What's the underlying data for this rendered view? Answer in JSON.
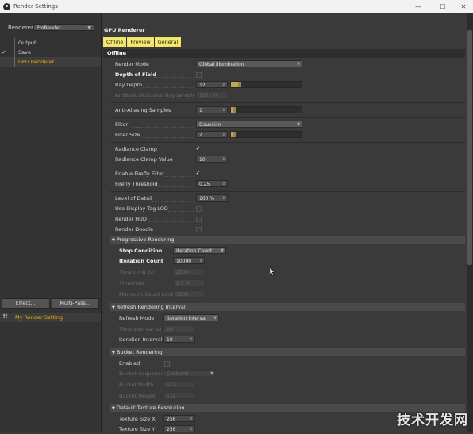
{
  "window": {
    "title": "Render Settings",
    "controls": [
      "—",
      "☐",
      "✕"
    ]
  },
  "left": {
    "renderer_label": "Renderer",
    "renderer_value": "ProRender",
    "tree": [
      {
        "label": "Output",
        "checked": false,
        "active": false
      },
      {
        "label": "Save",
        "checked": true,
        "active": false
      },
      {
        "label": "GPU Renderer",
        "checked": false,
        "active": true
      }
    ],
    "effect_button": "Effect...",
    "multipass_button": "Multi-Pass...",
    "setting_name": "My Render Setting"
  },
  "right": {
    "panel_title": "GPU Renderer",
    "tabs": [
      {
        "label": "Offline",
        "active": true
      },
      {
        "label": "Preview",
        "active": true
      },
      {
        "label": "General",
        "active": true
      }
    ],
    "section": "Offline",
    "render_mode": {
      "label": "Render Mode",
      "value": "Global Illumination"
    },
    "depth_of_field": {
      "label": "Depth of Field"
    },
    "ray_depth": {
      "label": "Ray Depth",
      "value": "12",
      "level": 0.12
    },
    "ambient_occlusion": {
      "label": "Ambient Occlusion Ray Length",
      "value": "100 cm"
    },
    "aa_samples": {
      "label": "Anti-Aliasing Samples",
      "value": "1",
      "level": 0.04
    },
    "filter": {
      "label": "Filter",
      "value": "Gaussian"
    },
    "filter_size": {
      "label": "Filter Size",
      "value": "2",
      "level": 0.06
    },
    "radiance_clamp": {
      "label": "Radiance Clamp"
    },
    "radiance_clamp_value": {
      "label": "Radiance Clamp Value",
      "value": "10"
    },
    "enable_firefly": {
      "label": "Enable Firefly Filter"
    },
    "firefly_threshold": {
      "label": "Firefly Threshold",
      "value": "0.25"
    },
    "level_of_detail": {
      "label": "Level of Detail",
      "value": "100 %"
    },
    "use_display_tag_lod": {
      "label": "Use Display Tag LOD"
    },
    "render_hud": {
      "label": "Render HUD"
    },
    "render_doodle": {
      "label": "Render Doodle"
    },
    "progressive": {
      "title": "Progressive Rendering",
      "stop_condition": {
        "label": "Stop Condition",
        "value": "Iteration Count"
      },
      "iteration_count": {
        "label": "Iteration Count",
        "value": "10000"
      },
      "time_limit": {
        "label": "Time Limit (s)",
        "value": "2000"
      },
      "threshold": {
        "label": "Threshold",
        "value": "0.5 %"
      },
      "min_count": {
        "label": "Minimum Count Limit",
        "value": "1000"
      }
    },
    "refresh": {
      "title": "Refresh Rendering Interval",
      "mode": {
        "label": "Refresh Mode",
        "value": "Iteration Interval"
      },
      "time_interval": {
        "label": "Time Interval (s)",
        "value": "10"
      },
      "iteration_interval": {
        "label": "Iteration Interval",
        "value": "10"
      }
    },
    "bucket": {
      "title": "Bucket Rendering",
      "enabled": {
        "label": "Enabled"
      },
      "sequence": {
        "label": "Bucket Sequence",
        "value": "Centered"
      },
      "width": {
        "label": "Bucket Width",
        "value": "512"
      },
      "height": {
        "label": "Bucket Height",
        "value": "512"
      }
    },
    "texture": {
      "title": "Default Texture Resolution",
      "size_x": {
        "label": "Texture Size X",
        "value": "256"
      },
      "size_y": {
        "label": "Texture Size Y",
        "value": "256"
      }
    }
  },
  "watermark": "技术开发网"
}
